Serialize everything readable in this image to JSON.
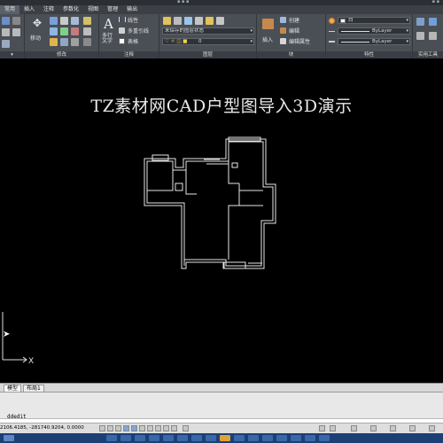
{
  "ribbon": {
    "tabs": [
      "常用",
      "插入",
      "注释",
      "参数化",
      "视图",
      "管理",
      "输出"
    ],
    "active_tab": 0,
    "modify": {
      "move_label": "移动",
      "panel_title": "修改"
    },
    "annotation": {
      "text_label": "多行\n文字",
      "linear_label": "线性",
      "multileader_label": "多重引线",
      "table_label": "表格",
      "panel_title": "注释"
    },
    "layers": {
      "state_value": "未保存的图层状态",
      "current_layer_value": "0",
      "panel_title": "图层"
    },
    "block": {
      "insert_label": "插入",
      "create_label": "创建",
      "edit_label": "编辑",
      "edit_attr_label": "编辑属性",
      "panel_title": "块"
    },
    "properties": {
      "color_value": "白",
      "linetype_value": "ByLayer",
      "lineweight_value": "ByLayer",
      "panel_title": "特性"
    },
    "utilities": {
      "panel_title": "实用工具"
    },
    "left_panel_title": ""
  },
  "canvas": {
    "title": "TZ素材网CAD户型图导入3D演示",
    "ucs_x_label": "X"
  },
  "layout_tabs": [
    "模型",
    "布局1"
  ],
  "command": {
    "history": "ddedit"
  },
  "status": {
    "coords": "2106.4185, -281740.9204, 0.0000"
  },
  "colors": {
    "ribbon_bg": "#4a4f56",
    "viewport_bg": "#000000",
    "taskbar_bg": "#1c3f74"
  }
}
